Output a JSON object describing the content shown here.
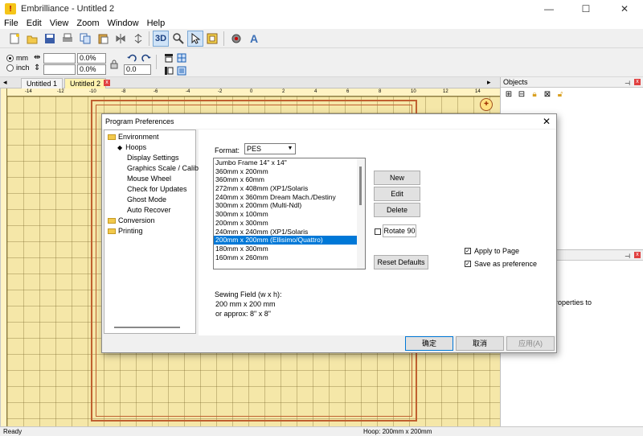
{
  "window": {
    "app_title": "Embrilliance - Untitled 2",
    "app_icon": "!",
    "minimize": "—",
    "maximize": "☐",
    "close": "✕"
  },
  "menu": [
    "File",
    "Edit",
    "View",
    "Zoom",
    "Window",
    "Help"
  ],
  "toolbar2": {
    "unit_mm": "mm",
    "unit_inch": "inch",
    "percent_1": "0.0%",
    "percent_2": "0.0%",
    "angle": "0.0"
  },
  "doc_tabs": [
    "Untitled 1",
    "Untitled 2"
  ],
  "tab_close": "x",
  "ruler_labels": [
    "-14",
    "-12",
    "-10",
    "-8",
    "-6",
    "-4",
    "-2",
    "0",
    "2",
    "4",
    "6",
    "8",
    "10",
    "12",
    "14"
  ],
  "objects_panel": {
    "title": "Objects",
    "pin": "⊣",
    "close": "x"
  },
  "props_panel": {
    "partial_text": "roperties to"
  },
  "status": {
    "left": "Ready",
    "hoop": "Hoop: 200mm x 200mm"
  },
  "dialog": {
    "title": "Program Preferences",
    "close": "✕",
    "tree": {
      "environment": "Environment",
      "hoops": "Hoops",
      "display_settings": "Display Settings",
      "graphics_scale": "Graphics Scale / Calibr",
      "mouse_wheel": "Mouse Wheel",
      "check_updates": "Check for Updates",
      "ghost_mode": "Ghost Mode",
      "auto_recover": "Auto Recover",
      "conversion": "Conversion",
      "printing": "Printing"
    },
    "format_label": "Format:",
    "format_value": "PES",
    "hoops": [
      "Jumbo Frame 14\" x 14\"",
      "360mm x 200mm",
      "360mm x 60mm",
      "272mm x 408mm (XP1/Solaris",
      "240mm x 360mm Dream Mach./Destiny",
      "300mm x 200mm (Multi-Ndl)",
      "300mm x 100mm",
      "200mm x 300mm",
      "240mm x 240mm (XP1/Solaris",
      "200mm x 200mm (Ellisimo/Quattro)",
      "180mm x 300mm",
      "160mm x 260mm"
    ],
    "selected_hoop_index": 9,
    "new_btn": "New",
    "edit_btn": "Edit",
    "delete_btn": "Delete",
    "rotate_label": "Rotate 90",
    "reset_btn": "Reset Defaults",
    "apply_label": "Apply to Page",
    "save_pref_label": "Save as preference",
    "sewing_field_label": "Sewing Field (w x h):",
    "sewing_field_mm": "200 mm x 200 mm",
    "sewing_field_in": "or approx: 8\" x 8\"",
    "ok_btn": "确定",
    "cancel_btn": "取消",
    "apply_btn": "应用(A)"
  },
  "colors": {
    "canvas": "#f5e7a8",
    "hoop_frame": "#c06030",
    "selection": "#0078d7"
  }
}
